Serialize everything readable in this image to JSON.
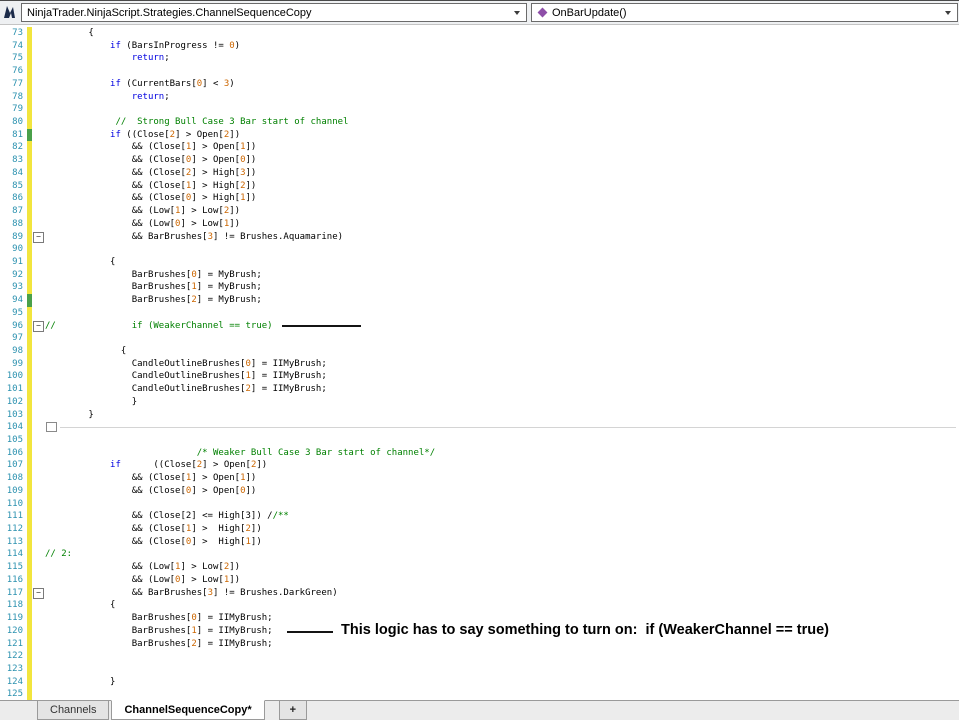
{
  "toolbar": {
    "type_dropdown": "NinjaTrader.NinjaScript.Strategies.ChannelSequenceCopy",
    "member_dropdown": "OnBarUpdate()"
  },
  "icons": {
    "ninjatrader-icon": "dark app glyph",
    "chevron-down-icon": "small down triangle",
    "method-icon": "purple diamond",
    "fold-collapse-icon": "minus box"
  },
  "colors": {
    "line_number": "#2b91af",
    "keyword": "#0000e0",
    "number": "#cc6600",
    "comment": "#008000",
    "change_marker_unsaved": "#f2e53e",
    "change_marker_saved": "#4aa04a",
    "method_icon": "#8e4fa8"
  },
  "annotations": {
    "note_text": "This logic has to say something to turn on:  if (WeakerChannel == true)"
  },
  "tabs": [
    {
      "label": "Channels",
      "name": "tab-channels",
      "active": false,
      "plus": false
    },
    {
      "label": "ChannelSequenceCopy*",
      "name": "tab-channelsequencecopy",
      "active": true,
      "plus": false
    },
    {
      "label": "+",
      "name": "new-tab-button",
      "active": false,
      "plus": true
    }
  ],
  "editor": {
    "first_line": 73,
    "last_line": 125,
    "lines": [
      {
        "n": 73,
        "t": "        {",
        "m": "y"
      },
      {
        "n": 74,
        "t": "            if (BarsInProgress != 0)",
        "m": "y"
      },
      {
        "n": 75,
        "t": "                return;",
        "m": "y"
      },
      {
        "n": 76,
        "t": "",
        "m": "y"
      },
      {
        "n": 77,
        "t": "            if (CurrentBars[0] < 3)",
        "m": "y"
      },
      {
        "n": 78,
        "t": "                return;",
        "m": "y"
      },
      {
        "n": 79,
        "t": "",
        "m": "y"
      },
      {
        "n": 80,
        "t": "             //  Strong Bull Case 3 Bar start of channel",
        "m": "y"
      },
      {
        "n": 81,
        "t": "            if ((Close[2] > Open[2])",
        "m": "g"
      },
      {
        "n": 82,
        "t": "                && (Close[1] > Open[1])",
        "m": "y"
      },
      {
        "n": 83,
        "t": "                && (Close[0] > Open[0])",
        "m": "y"
      },
      {
        "n": 84,
        "t": "                && (Close[2] > High[3])",
        "m": "y"
      },
      {
        "n": 85,
        "t": "                && (Close[1] > High[2])",
        "m": "y"
      },
      {
        "n": 86,
        "t": "                && (Close[0] > High[1])",
        "m": "y"
      },
      {
        "n": 87,
        "t": "                && (Low[1] > Low[2])",
        "m": "y"
      },
      {
        "n": 88,
        "t": "                && (Low[0] > Low[1])",
        "m": "y"
      },
      {
        "n": 89,
        "t": "                && BarBrushes[3] != Brushes.Aquamarine)",
        "m": "y",
        "f": true
      },
      {
        "n": 90,
        "t": "",
        "m": "y"
      },
      {
        "n": 91,
        "t": "            {",
        "m": "y"
      },
      {
        "n": 92,
        "t": "                BarBrushes[0] = MyBrush;",
        "m": "y"
      },
      {
        "n": 93,
        "t": "                BarBrushes[1] = MyBrush;",
        "m": "y"
      },
      {
        "n": 94,
        "t": "                BarBrushes[2] = MyBrush;",
        "m": "g"
      },
      {
        "n": 95,
        "t": "",
        "m": "y"
      },
      {
        "n": 96,
        "t": "//              if (WeakerChannel == true)",
        "m": "y",
        "f": true
      },
      {
        "n": 97,
        "t": "",
        "m": "y"
      },
      {
        "n": 98,
        "t": "              {",
        "m": "y"
      },
      {
        "n": 99,
        "t": "                CandleOutlineBrushes[0] = IIMyBrush;",
        "m": "y"
      },
      {
        "n": 100,
        "t": "                CandleOutlineBrushes[1] = IIMyBrush;",
        "m": "y"
      },
      {
        "n": 101,
        "t": "                CandleOutlineBrushes[2] = IIMyBrush;",
        "m": "y"
      },
      {
        "n": 102,
        "t": "                }",
        "m": "y"
      },
      {
        "n": 103,
        "t": "        }",
        "m": "y"
      },
      {
        "n": 104,
        "t": "",
        "m": "y",
        "box": true
      },
      {
        "n": 105,
        "t": "",
        "m": "y"
      },
      {
        "n": 106,
        "t": "                            /* Weaker Bull Case 3 Bar start of channel*/",
        "m": "y"
      },
      {
        "n": 107,
        "t": "            if      ((Close[2] > Open[2])",
        "m": "y"
      },
      {
        "n": 108,
        "t": "                && (Close[1] > Open[1])",
        "m": "y"
      },
      {
        "n": 109,
        "t": "                && (Close[0] > Open[0])",
        "m": "y"
      },
      {
        "n": 110,
        "t": "",
        "m": "y"
      },
      {
        "n": 111,
        "t": "                && (Close[2] <= High[3]) //**",
        "m": "y"
      },
      {
        "n": 112,
        "t": "                && (Close[1] >  High[2])",
        "m": "y"
      },
      {
        "n": 113,
        "t": "                && (Close[0] >  High[1])",
        "m": "y"
      },
      {
        "n": 114,
        "t": "// 2:",
        "m": "y"
      },
      {
        "n": 115,
        "t": "                && (Low[1] > Low[2])",
        "m": "y"
      },
      {
        "n": 116,
        "t": "                && (Low[0] > Low[1])",
        "m": "y"
      },
      {
        "n": 117,
        "t": "                && BarBrushes[3] != Brushes.DarkGreen)",
        "m": "y",
        "f": true
      },
      {
        "n": 118,
        "t": "            {",
        "m": "y"
      },
      {
        "n": 119,
        "t": "                BarBrushes[0] = IIMyBrush;",
        "m": "y"
      },
      {
        "n": 120,
        "t": "                BarBrushes[1] = IIMyBrush;",
        "m": "y"
      },
      {
        "n": 121,
        "t": "                BarBrushes[2] = IIMyBrush;",
        "m": "y"
      },
      {
        "n": 122,
        "t": "",
        "m": "y"
      },
      {
        "n": 123,
        "t": "",
        "m": "y"
      },
      {
        "n": 124,
        "t": "            }",
        "m": "y"
      },
      {
        "n": 125,
        "t": "",
        "m": "y"
      }
    ]
  }
}
